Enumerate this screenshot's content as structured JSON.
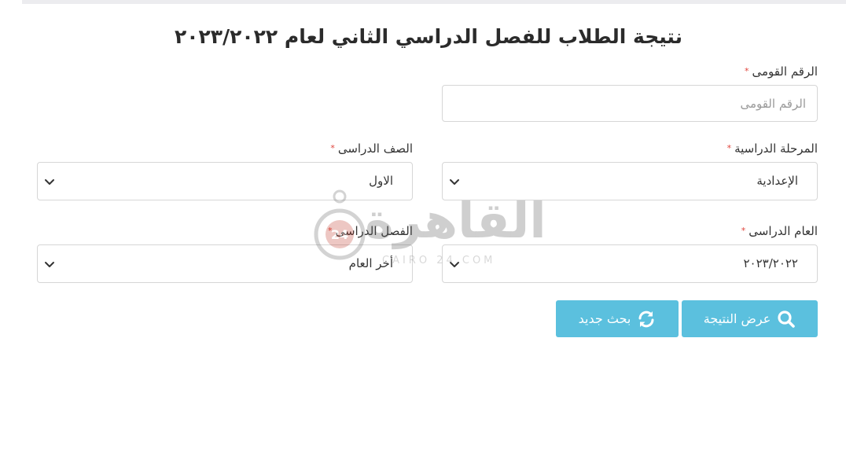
{
  "page_title": "نتيجة الطلاب للفصل الدراسي الثاني لعام ٢٠٢٣/٢٠٢٢",
  "required_marker": "*",
  "national_id": {
    "label": "الرقم القومى",
    "placeholder": "الرقم القومى",
    "value": ""
  },
  "stage": {
    "label": "المرحلة الدراسية",
    "selected": "الإعدادية"
  },
  "grade": {
    "label": "الصف الدراسى",
    "selected": "الاول"
  },
  "year": {
    "label": "العام الدراسى",
    "selected": "٢٠٢٣/٢٠٢٢"
  },
  "term": {
    "label": "الفصل الدراسى",
    "selected": "أخر العام"
  },
  "buttons": {
    "show_result": "عرض النتيجة",
    "new_search": "بحث جديد"
  },
  "watermark": {
    "text": "القاهرة",
    "sub": "CAIRO 24.COM"
  },
  "colors": {
    "button": "#5bc0de",
    "required": "#e0443b"
  },
  "icons": {
    "show_result": "search-icon",
    "new_search": "refresh-icon",
    "dropdown": "chevron-down-icon"
  }
}
